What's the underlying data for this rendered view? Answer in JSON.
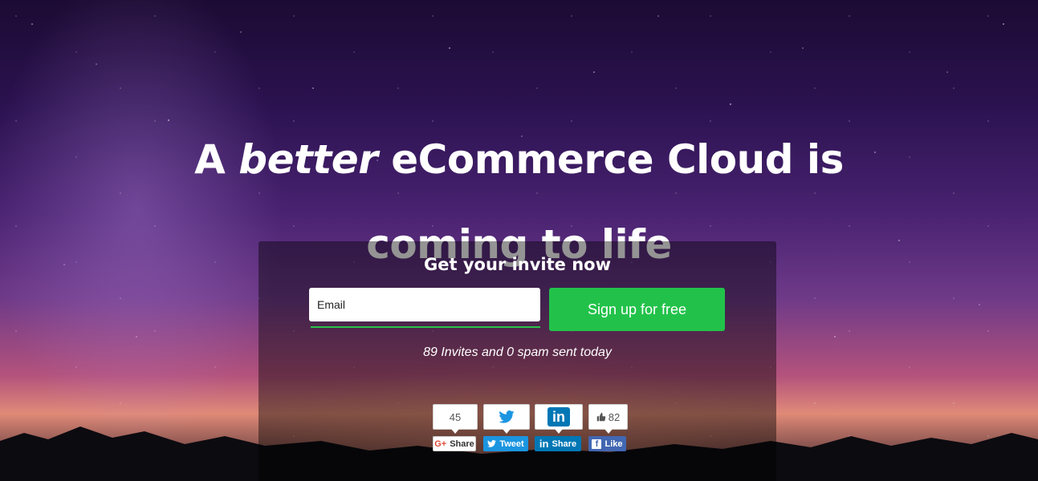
{
  "hero": {
    "headline_part1": "A ",
    "headline_emphasis": "better",
    "headline_part2": " eCommerce Cloud is",
    "headline_line2": "coming to life"
  },
  "signup": {
    "title": "Get your invite now",
    "email_placeholder": "Email",
    "button_label": "Sign up for free",
    "invites_text": "89 Invites and 0 spam sent today"
  },
  "social": {
    "google_plus": {
      "count": "45",
      "label": "Share",
      "logo_text": "G+"
    },
    "twitter": {
      "label": "Tweet"
    },
    "linkedin": {
      "label": "Share",
      "logo_text": "in"
    },
    "facebook": {
      "count": "82",
      "label": "Like",
      "logo_text": "f"
    }
  },
  "colors": {
    "accent_green": "#22c24a",
    "twitter_blue": "#1b95e0",
    "linkedin_blue": "#0077b5",
    "facebook_blue": "#4267b2"
  }
}
